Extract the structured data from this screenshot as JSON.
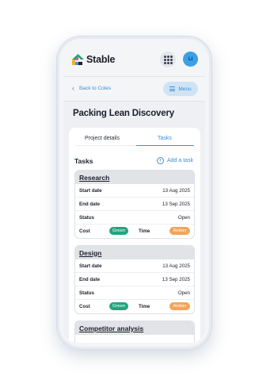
{
  "app": {
    "name": "Stable",
    "user_initials": "LI"
  },
  "nav": {
    "back_label": "Back to Coles",
    "menu_label": "Menu"
  },
  "page": {
    "title": "Packing Lean Discovery"
  },
  "tabs": [
    {
      "label": "Project details",
      "active": false
    },
    {
      "label": "Tasks",
      "active": true
    }
  ],
  "tasks_section": {
    "heading": "Tasks",
    "add_label": "Add a task"
  },
  "labels": {
    "start": "Start date",
    "end": "End date",
    "status": "Status",
    "cost": "Cost",
    "time": "Time"
  },
  "tasks": [
    {
      "name": "Research",
      "start": "13 Aug 2025",
      "end": "13 Sep 2025",
      "status": "Open",
      "cost": "Green",
      "time": "Amber"
    },
    {
      "name": "Design",
      "start": "13 Aug 2025",
      "end": "13 Sep 2025",
      "status": "Open",
      "cost": "Green",
      "time": "Amber"
    },
    {
      "name": "Competitor analysis"
    }
  ],
  "colors": {
    "accent": "#3d8fd6",
    "green": "#1fa67f",
    "amber": "#f2a45a",
    "avatar": "#3aa0e8"
  }
}
